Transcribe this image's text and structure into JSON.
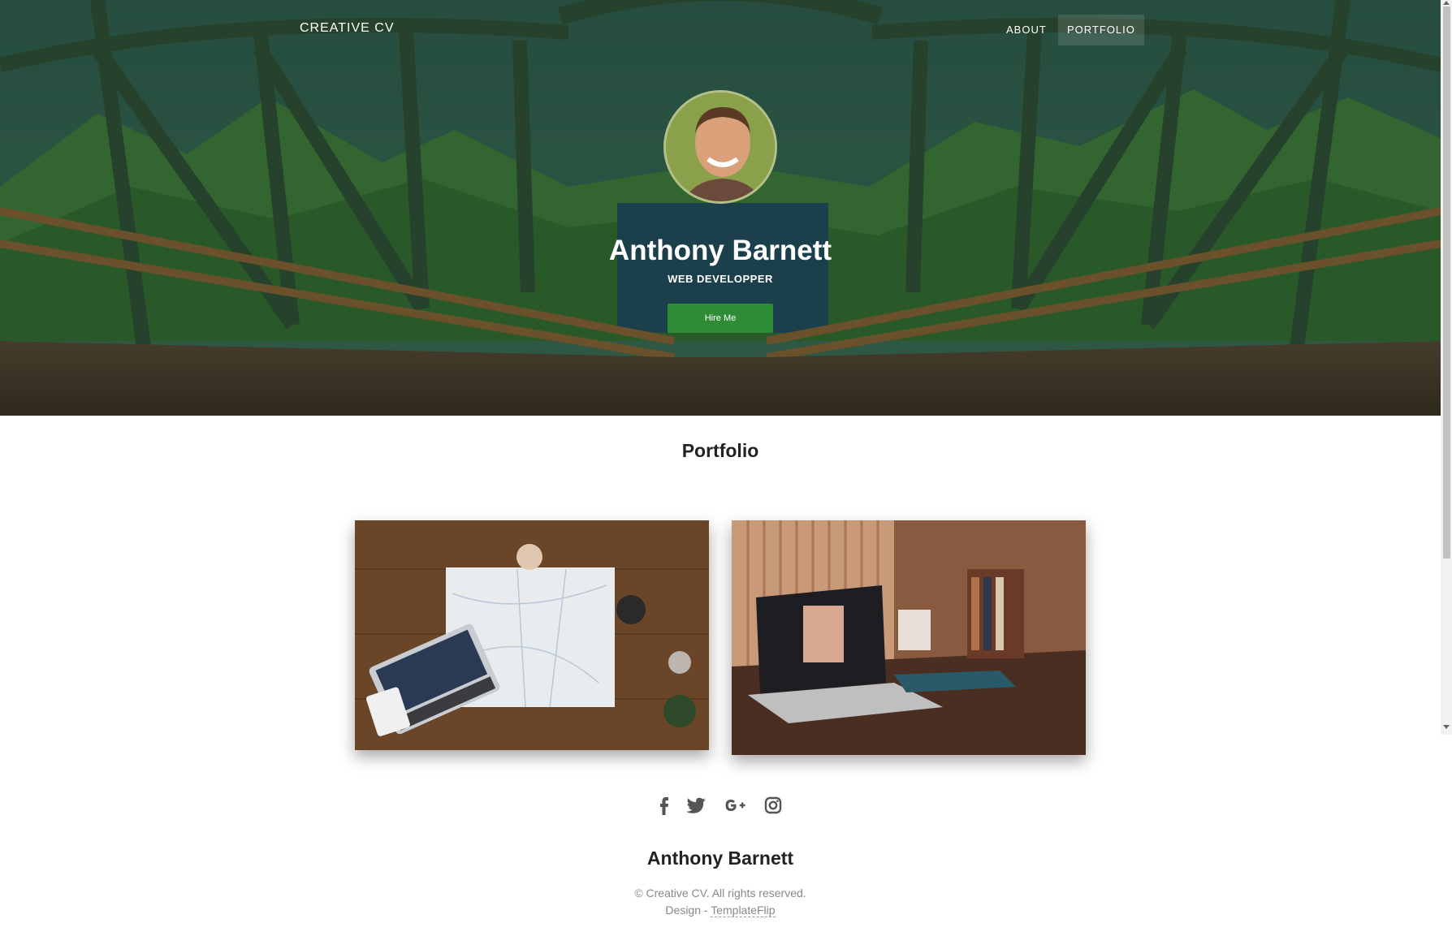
{
  "nav": {
    "brand": "CREATIVE CV",
    "links": [
      {
        "label": "ABOUT",
        "active": false
      },
      {
        "label": "PORTFOLIO",
        "active": true
      }
    ]
  },
  "hero": {
    "name": "Anthony Barnett",
    "role": "WEB DEVELOPPER",
    "cta_label": "Hire Me",
    "cta_color": "#2e8b36"
  },
  "portfolio": {
    "title": "Portfolio",
    "items": [
      {
        "image": "travel-map-desk-photo"
      },
      {
        "image": "laptop-desk-photo"
      }
    ]
  },
  "footer": {
    "social": [
      {
        "icon": "facebook-icon"
      },
      {
        "icon": "twitter-icon"
      },
      {
        "icon": "google-plus-icon"
      },
      {
        "icon": "instagram-icon"
      }
    ],
    "name": "Anthony Barnett",
    "copyright": "© Creative CV. All rights reserved.",
    "design_prefix": "Design - ",
    "design_link": "TemplateFlip"
  }
}
